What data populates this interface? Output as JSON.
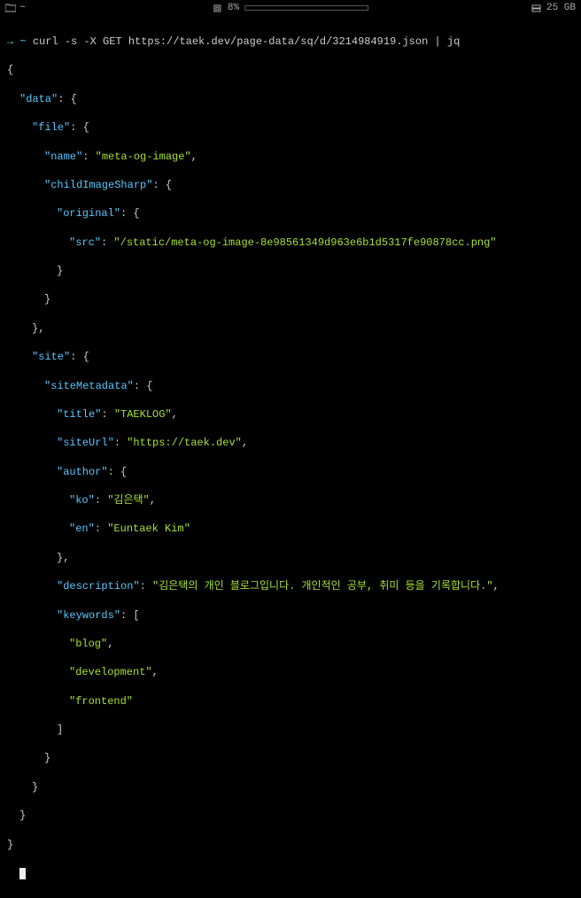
{
  "statusbar": {
    "cwd": "~",
    "cpu_pct": "8%",
    "disk": "25 GB"
  },
  "prompt": {
    "arrow": "→",
    "tilde": "~",
    "command": "curl -s -X GET https://taek.dev/page-data/sq/d/3214984919.json | jq"
  },
  "json": {
    "k_data": "\"data\"",
    "k_file": "\"file\"",
    "k_name": "\"name\"",
    "v_name": "\"meta-og-image\"",
    "k_childImageSharp": "\"childImageSharp\"",
    "k_original": "\"original\"",
    "k_src": "\"src\"",
    "v_src": "\"/static/meta-og-image-8e98561349d963e6b1d5317fe90878cc.png\"",
    "k_site": "\"site\"",
    "k_siteMetadata": "\"siteMetadata\"",
    "k_title": "\"title\"",
    "v_title": "\"TAEKLOG\"",
    "k_siteUrl": "\"siteUrl\"",
    "v_siteUrl": "\"https://taek.dev\"",
    "k_author": "\"author\"",
    "k_ko": "\"ko\"",
    "v_ko": "\"김은택\"",
    "k_en": "\"en\"",
    "v_en": "\"Euntaek Kim\"",
    "k_description": "\"description\"",
    "v_description": "\"김은택의 개인 블로그입니다. 개인적인 공부, 취미 등을 기록합니다.\"",
    "k_keywords": "\"keywords\"",
    "v_kw0": "\"blog\"",
    "v_kw1": "\"development\"",
    "v_kw2": "\"frontend\""
  }
}
